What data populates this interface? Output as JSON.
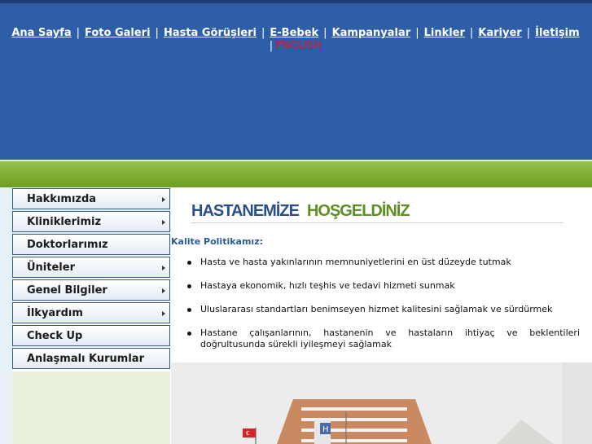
{
  "nav": {
    "items": [
      "Ana Sayfa",
      "Foto Galeri",
      "Hasta Görüşleri",
      "E-Bebek",
      "Kampanyalar",
      "Linkler",
      "Kariyer",
      "İletişim"
    ],
    "separator": "|",
    "english": "ENGLISH"
  },
  "sidebar": {
    "items": [
      {
        "label": "Hakkımızda"
      },
      {
        "label": "Kliniklerimiz"
      },
      {
        "label": "Doktorlarımız"
      },
      {
        "label": "Üniteler"
      },
      {
        "label": "Genel Bilgiler"
      },
      {
        "label": "İlkyardım"
      },
      {
        "label": "Check Up"
      },
      {
        "label": "Anlaşmalı Kurumlar"
      }
    ]
  },
  "main": {
    "welcome_part1": "HASTANEMİZE",
    "welcome_part2": "HOŞGELDİNİZ",
    "policy_title": "Kalite Politikamız:",
    "policies": [
      "Hasta ve hasta yakınlarının memnuniyetlerini en üst düzeyde tutmak",
      "Hastaya ekonomik, hızlı teşhis ve tedavi hizmeti sunmak",
      "Uluslararası standartları benimseyen hizmet kalitesini sağlamak ve sürdürmek",
      "Hastane çalışanlarının, hastanenin ve hastaların ihtiyaç ve beklentileri doğrultusunda sürekli iyileşmeyi sağlamak"
    ],
    "photo_sign": "H"
  },
  "colors": {
    "header_blue": "#2f5ea8",
    "green_band": "#7aab2f",
    "link_red": "#e0141e",
    "title_blue": "#2a4f86",
    "title_green": "#5e8f22"
  }
}
